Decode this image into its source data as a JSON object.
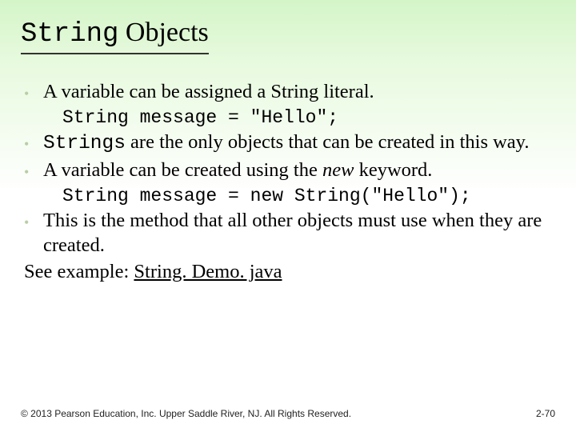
{
  "title": {
    "code": "String",
    "rest": " Objects"
  },
  "bullets": {
    "b1": "A variable can be assigned a String literal.",
    "code1": "String message = \"Hello\";",
    "b2_code": "Strings",
    "b2_rest": " are the only objects that can be created in this way.",
    "b3_pre": "A variable can be created using the ",
    "b3_italic": "new",
    "b3_post": " keyword.",
    "code2": "String message = new String(\"Hello\");",
    "b4": "This is the method that all other objects must use when they are created."
  },
  "see": {
    "prefix": "See example: ",
    "link": "String. Demo. java"
  },
  "footer": {
    "copyright": "© 2013 Pearson Education, Inc. Upper Saddle River, NJ. All Rights Reserved.",
    "page": "2-70"
  }
}
